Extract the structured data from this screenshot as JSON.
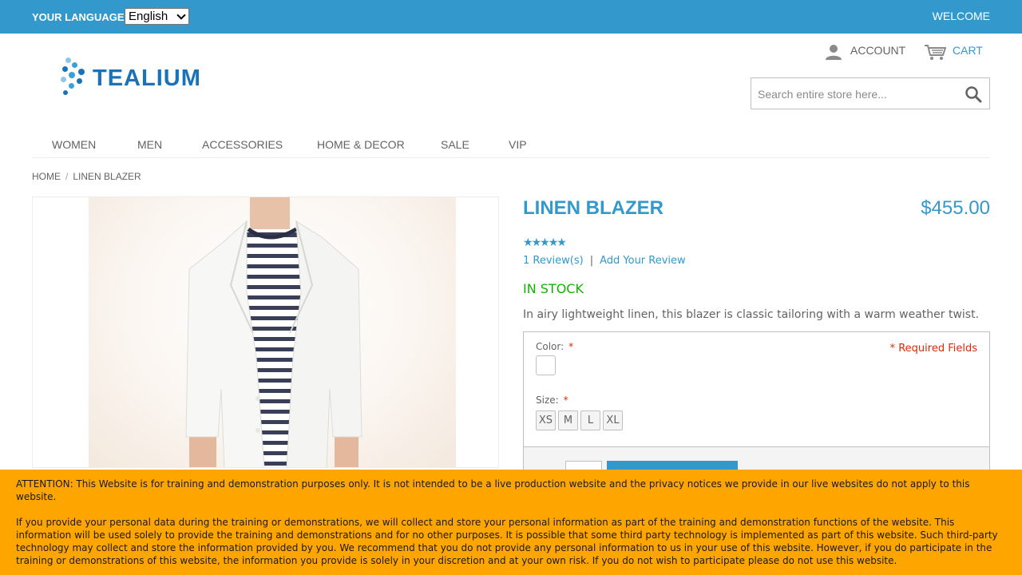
{
  "topbar": {
    "language_label": "YOUR LANGUAGE:",
    "language_value": "English",
    "welcome": "WELCOME"
  },
  "header": {
    "logo_text": "TEALIUM",
    "account_label": "ACCOUNT",
    "cart_label": "CART",
    "search_placeholder": "Search entire store here..."
  },
  "nav": {
    "items": [
      "WOMEN",
      "MEN",
      "ACCESSORIES",
      "HOME & DECOR",
      "SALE",
      "VIP"
    ]
  },
  "breadcrumb": {
    "home": "HOME",
    "separator": "/",
    "current": "LINEN BLAZER"
  },
  "product": {
    "name": "LINEN BLAZER",
    "price": "$455.00",
    "rating_stars": 5,
    "reviews_link": "1 Review(s)",
    "review_separator": "|",
    "add_review_link": "Add Your Review",
    "availability": "IN STOCK",
    "description": "In airy lightweight linen, this blazer is classic tailoring with a warm weather twist.",
    "options": {
      "color_label": "Color:",
      "size_label": "Size:",
      "required_marker": "*",
      "required_note": "* Required Fields",
      "sizes": [
        "XS",
        "M",
        "L",
        "XL"
      ]
    }
  },
  "notice": {
    "paragraph1": "ATTENTION: This Website is for training and demonstration purposes only. It is not intended to be a live production website and the privacy notices we provide in our live websites do not apply to this website.",
    "paragraph2": "If you provide your personal data during the training or demonstrations, we will collect and store your personal information as part of the training and demonstration functions of the website. This information will be used solely to provide the training and demonstrations and for no other purposes. It is possible that some third party technology is implemented as part of this website. Such third-party technology may collect and store the information provided by you. We recommend that you do not provide any personal information to us in your use of this website. However, if you do participate in the training or demonstrations of this website, the information you provide is solely in your discretion and at your own risk. If you do not wish to participate please do not use this website."
  },
  "colors": {
    "brand_blue": "#3399cc",
    "stock_green": "#11b400",
    "required_red": "#df280a",
    "notice_orange": "#ffa500"
  }
}
